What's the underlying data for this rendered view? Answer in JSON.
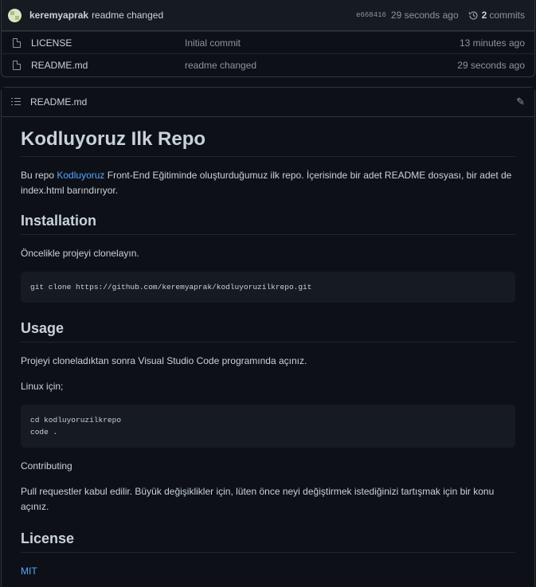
{
  "commit": {
    "author": "keremyaprak",
    "message": "readme changed",
    "sha": "e668416",
    "time": "29 seconds ago",
    "count": "2",
    "commits_label": "commits"
  },
  "files": [
    {
      "name": "LICENSE",
      "message": "Initial commit",
      "age": "13 minutes ago"
    },
    {
      "name": "README.md",
      "message": "readme changed",
      "age": "29 seconds ago"
    }
  ],
  "readme": {
    "filename": "README.md",
    "title": "Kodluyoruz Ilk Repo",
    "intro_before": "Bu repo ",
    "intro_link": "Kodluyoruz",
    "intro_after": " Front-End Eğitiminde oluşturduğumuz ilk repo. İçerisinde bir adet README dosyası, bir adet de index.html barındırıyor.",
    "installation_heading": "Installation",
    "installation_text": "Öncelikle projeyi clonelayın.",
    "installation_code": "git clone https://github.com/keremyaprak/kodluyoruzilkrepo.git",
    "usage_heading": "Usage",
    "usage_text": "Projeyi cloneladıktan sonra Visual Studio Code programında açınız.",
    "linux_text": "Linux için;",
    "usage_code": "cd kodluyoruzilkrepo\ncode .",
    "contributing_text": "Contributing",
    "pull_text": "Pull requestler kabul edilir. Büyük değişiklikler için, lüten önce neyi değiştirmek istediğinizi tartışmak için bir konu açınız.",
    "license_heading": "License",
    "license_link": "MIT"
  }
}
